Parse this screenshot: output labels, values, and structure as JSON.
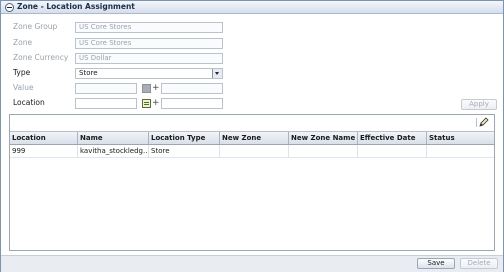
{
  "window": {
    "title": "Zone - Location Assignment"
  },
  "form": {
    "zone_group": {
      "label": "Zone Group",
      "value": "US Core Stores"
    },
    "zone": {
      "label": "Zone",
      "value": "US Core Stores"
    },
    "zone_currency": {
      "label": "Zone Currency",
      "value": "US Dollar"
    },
    "type": {
      "label": "Type",
      "value": "Store"
    },
    "value": {
      "label": "Value",
      "value": ""
    },
    "location": {
      "label": "Location",
      "value": ""
    },
    "apply_label": "Apply"
  },
  "table": {
    "columns": [
      "Location",
      "Name",
      "Location Type",
      "New Zone",
      "New Zone Name",
      "Effective Date",
      "Status"
    ],
    "rows": [
      [
        "999",
        "kavitha_stockledg...",
        "Store",
        "",
        "",
        "",
        ""
      ]
    ]
  },
  "footer": {
    "save_label": "Save",
    "delete_label": "Delete"
  },
  "icons": {
    "title": "collapse-icon",
    "edit": "pencil-icon"
  }
}
